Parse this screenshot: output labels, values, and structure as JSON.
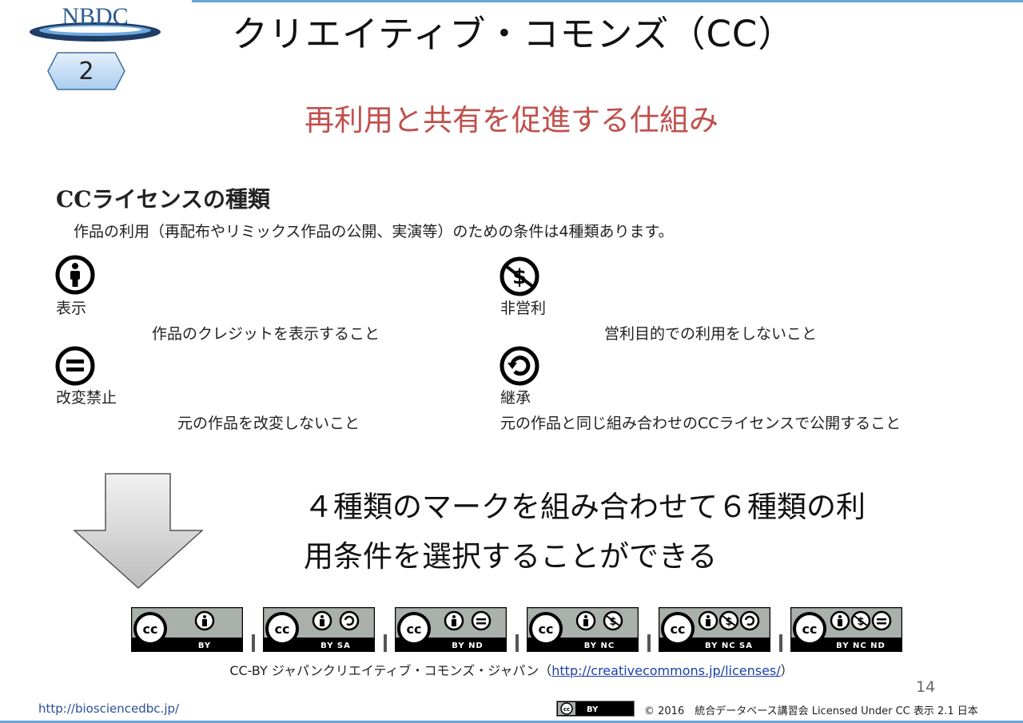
{
  "header": {
    "logo_text": "NBDC",
    "slide_badge": "2",
    "title": "クリエイティブ・コモンズ（CC）",
    "subtitle": "再利用と共有を促進する仕組み"
  },
  "panel": {
    "heading": "CCライセンスの種類",
    "intro": "作品の利用（再配布やリミックス作品の公開、実演等）のための条件は4種類あります。",
    "conditions": [
      {
        "icon": "attribution-icon",
        "name": "表示",
        "description": "作品のクレジットを表示すること"
      },
      {
        "icon": "noncommercial-icon",
        "name": "非営利",
        "description": "営利目的での利用をしないこと"
      },
      {
        "icon": "noderivatives-icon",
        "name": "改変禁止",
        "description": "元の作品を改変しないこと"
      },
      {
        "icon": "sharealike-icon",
        "name": "継承",
        "description": "元の作品と同じ組み合わせのCCライセンスで公開すること"
      }
    ]
  },
  "callout": {
    "line1": "４種類のマークを組み合わせて６種類の利",
    "line2": "用条件を選択することができる"
  },
  "licenses": [
    {
      "label": "BY",
      "parts": [
        "by"
      ]
    },
    {
      "label": "BY SA",
      "parts": [
        "by",
        "sa"
      ]
    },
    {
      "label": "BY ND",
      "parts": [
        "by",
        "nd"
      ]
    },
    {
      "label": "BY NC",
      "parts": [
        "by",
        "nc"
      ]
    },
    {
      "label": "BY NC SA",
      "parts": [
        "by",
        "nc",
        "sa"
      ]
    },
    {
      "label": "BY NC ND",
      "parts": [
        "by",
        "nc",
        "nd"
      ]
    }
  ],
  "license_badge_text": "cc",
  "credit": {
    "prefix": "CC-BY ジャパンクリエイティブ・コモンズ・ジャパン（",
    "link": "http://creativecommons.jp/licenses/",
    "suffix": "）"
  },
  "footer": {
    "page_number": "14",
    "url": "http://biosciencedbc.jp/",
    "badge_label": "BY",
    "copyright": "© 2016　統合データベース講習会 Licensed Under CC 表示 2.1 日本"
  },
  "colors": {
    "subtitle": "#c0504d",
    "accent_line": "#6aa7d8",
    "logo": "#2c5b8f",
    "arrow_fill": "#d9d9d9"
  }
}
